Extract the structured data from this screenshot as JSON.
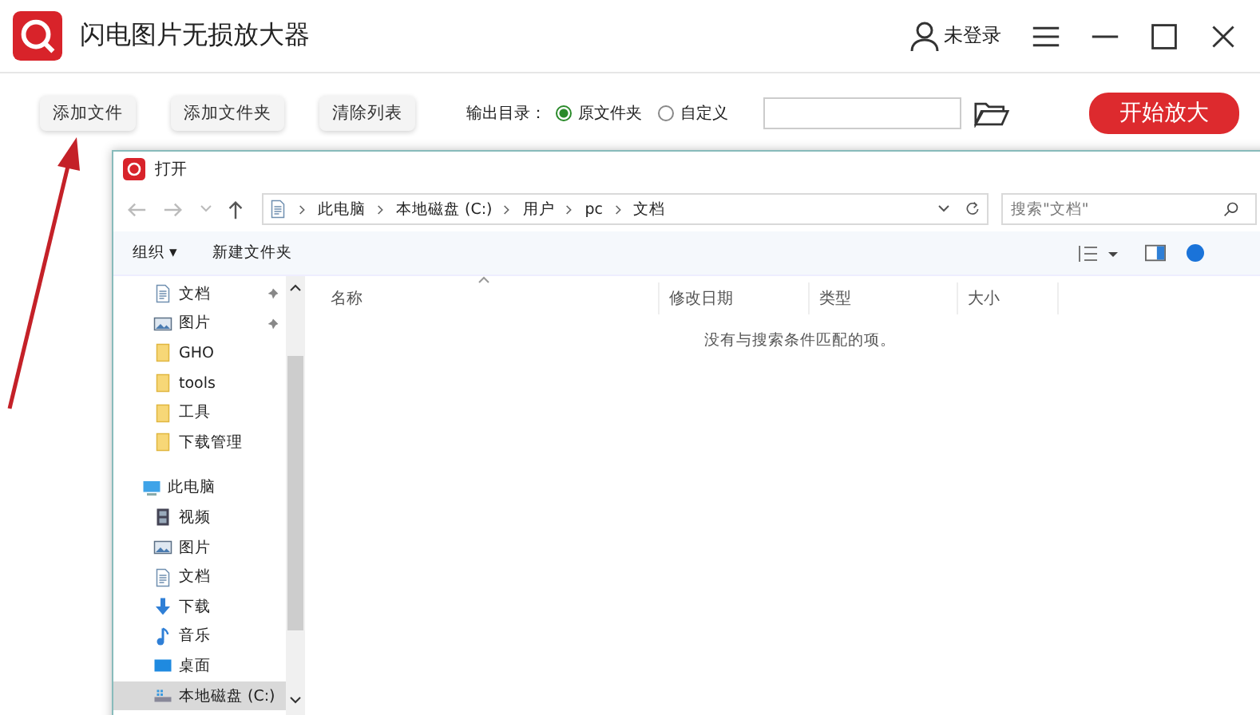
{
  "app": {
    "title": "闪电图片无损放大器",
    "user": "未登录"
  },
  "toolbar": {
    "buttons": [
      "添加文件",
      "添加文件夹",
      "清除列表"
    ],
    "output_label": "输出目录：",
    "output_options": [
      {
        "label": "原文件夹",
        "selected": true
      },
      {
        "label": "自定义",
        "selected": false
      }
    ],
    "start_button": "开始放大"
  },
  "dialog": {
    "title": "打开",
    "breadcrumb": [
      "此电脑",
      "本地磁盘 (C:)",
      "用户",
      "pc",
      "文档"
    ],
    "search": {
      "placeholder": "搜索\"文档\""
    },
    "commands": [
      "组织 ▾",
      "新建文件夹"
    ],
    "sidebar": [
      {
        "label": "文档",
        "kind": "doc",
        "pinned": true,
        "selected": false
      },
      {
        "label": "图片",
        "kind": "picture",
        "pinned": true,
        "selected": false
      },
      {
        "label": "GHO",
        "kind": "folder",
        "pinned": false,
        "selected": false
      },
      {
        "label": "tools",
        "kind": "folder",
        "pinned": false,
        "selected": false
      },
      {
        "label": "工具",
        "kind": "folder",
        "pinned": false,
        "selected": false
      },
      {
        "label": "下载管理",
        "kind": "folder",
        "pinned": false,
        "selected": false
      },
      {
        "label": "此电脑",
        "kind": "pc",
        "pinned": false,
        "selected": false,
        "children": [
          {
            "label": "视频",
            "kind": "video",
            "pinned": false,
            "selected": false
          },
          {
            "label": "图片",
            "kind": "picture",
            "pinned": false,
            "selected": false
          },
          {
            "label": "文档",
            "kind": "doc",
            "pinned": false,
            "selected": false
          },
          {
            "label": "下载",
            "kind": "download",
            "pinned": false,
            "selected": false
          },
          {
            "label": "音乐",
            "kind": "music",
            "pinned": false,
            "selected": false
          },
          {
            "label": "桌面",
            "kind": "desktop",
            "pinned": false,
            "selected": false
          },
          {
            "label": "本地磁盘 (C:)",
            "kind": "drive",
            "pinned": false,
            "selected": true
          }
        ]
      }
    ],
    "columns": [
      "名称",
      "修改日期",
      "类型",
      "大小"
    ],
    "empty_message": "没有与搜索条件匹配的项。"
  }
}
